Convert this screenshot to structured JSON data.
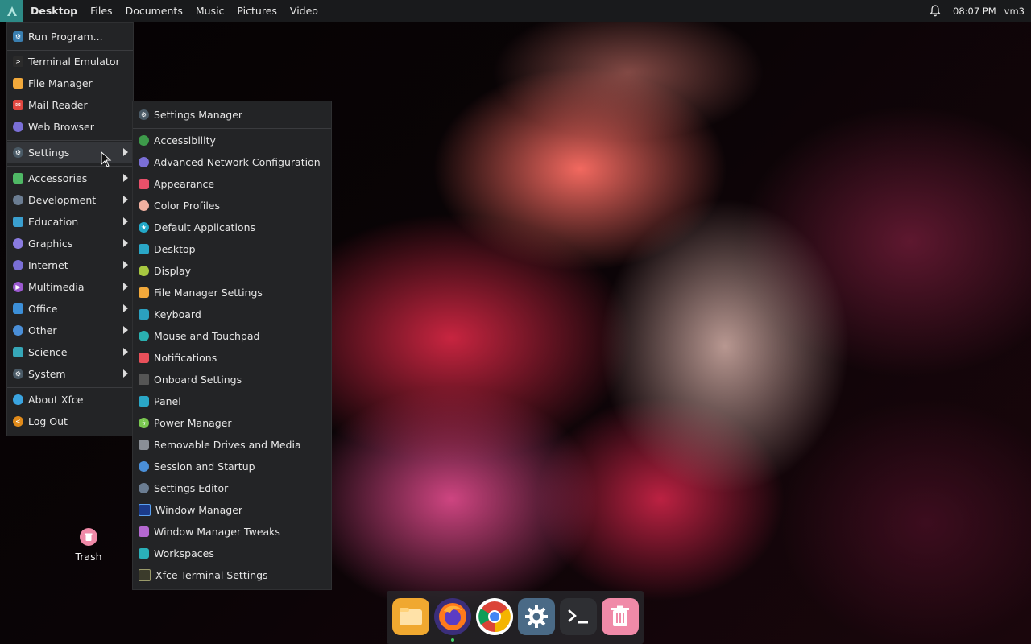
{
  "top_panel": {
    "items": [
      "Desktop",
      "Files",
      "Documents",
      "Music",
      "Pictures",
      "Video"
    ],
    "clock": "08:07 PM",
    "user": "vm3"
  },
  "main_menu": {
    "run_program": "Run Program...",
    "favorites": [
      "Terminal Emulator",
      "File Manager",
      "Mail Reader",
      "Web Browser"
    ],
    "settings": "Settings",
    "categories": [
      "Accessories",
      "Development",
      "Education",
      "Graphics",
      "Internet",
      "Multimedia",
      "Office",
      "Other",
      "Science",
      "System"
    ],
    "about": "About Xfce",
    "logout": "Log Out"
  },
  "settings_menu": {
    "manager": "Settings Manager",
    "items": [
      "Accessibility",
      "Advanced Network Configuration",
      "Appearance",
      "Color Profiles",
      "Default Applications",
      "Desktop",
      "Display",
      "File Manager Settings",
      "Keyboard",
      "Mouse and Touchpad",
      "Notifications",
      "Onboard Settings",
      "Panel",
      "Power Manager",
      "Removable Drives and Media",
      "Session and Startup",
      "Settings Editor",
      "Window Manager",
      "Window Manager Tweaks",
      "Workspaces",
      "Xfce Terminal Settings"
    ]
  },
  "desktop": {
    "trash_label": "Trash"
  },
  "dock": {
    "apps": [
      "file-manager-icon",
      "firefox-icon",
      "chrome-icon",
      "settings-icon",
      "terminal-icon",
      "trash-icon"
    ]
  },
  "colors": {
    "panel": "#191a1c",
    "menu": "#232426",
    "accent": "#2d8a86",
    "highlight": "#34363a"
  }
}
